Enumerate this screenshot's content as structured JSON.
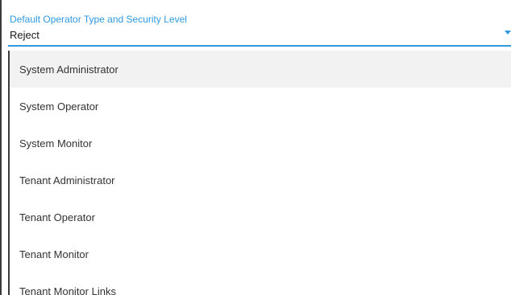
{
  "field": {
    "label": "Default Operator Type and Security Level",
    "value": "Reject",
    "arrow_icon": "caret-down-icon",
    "accent_color": "#2f9ae0"
  },
  "menu": {
    "highlighted_index": 0,
    "highlight_color": "#f2f2f2",
    "items": [
      {
        "label": "System Administrator"
      },
      {
        "label": "System Operator"
      },
      {
        "label": "System Monitor"
      },
      {
        "label": "Tenant Administrator"
      },
      {
        "label": "Tenant Operator"
      },
      {
        "label": "Tenant Monitor"
      },
      {
        "label": "Tenant Monitor Links"
      }
    ]
  }
}
